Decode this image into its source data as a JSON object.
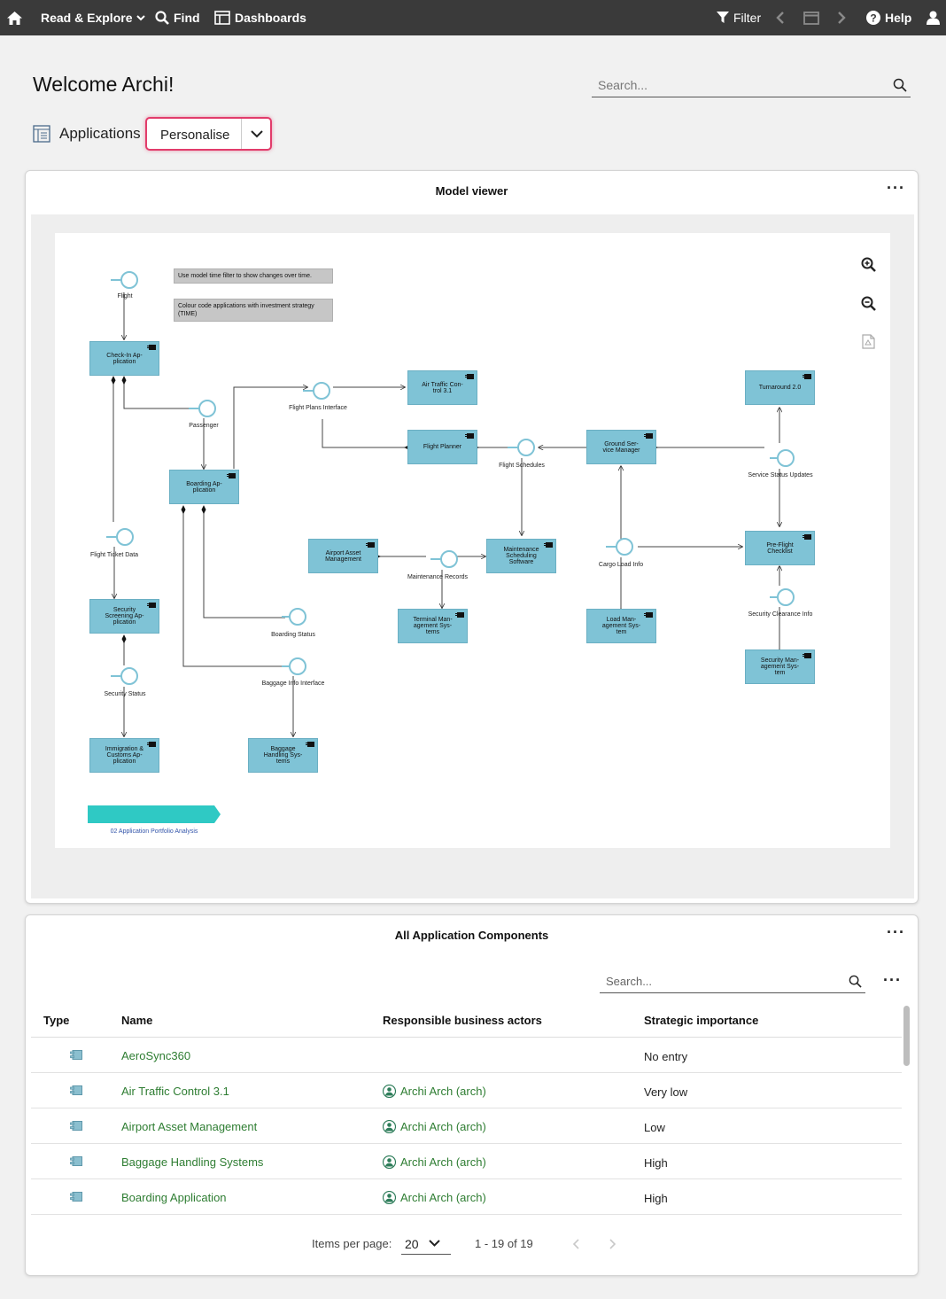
{
  "nav": {
    "read_explore": "Read & Explore",
    "find": "Find",
    "dashboards": "Dashboards",
    "filter": "Filter",
    "help": "Help"
  },
  "header": {
    "welcome": "Welcome Archi!",
    "search_placeholder": "Search..."
  },
  "context": {
    "label": "Applications",
    "personalise": "Personalise"
  },
  "model_viewer": {
    "title": "Model viewer",
    "notes": [
      "Use model time filter to show changes over time.",
      "Colour code applications with investment strategy (TIME)"
    ],
    "components": {
      "checkin": "Check-In Ap-\nplication",
      "atc": "Air Traffic Con-\ntrol 3.1",
      "turnaround": "Turnaround 2.0",
      "flight_planner": "Flight Planner",
      "ground_service": "Ground Ser-\nvice Manager",
      "boarding": "Boarding Ap-\nplication",
      "airport_asset": "Airport Asset\nManagement",
      "maintenance": "Maintenance\nScheduling\nSoftware",
      "preflight": "Pre-Flight\nChecklist",
      "security_screening": "Security\nScreening Ap-\nplication",
      "terminal": "Terminal Man-\nagement Sys-\ntems",
      "load": "Load Man-\nagement Sys-\ntem",
      "security_mgmt": "Security Man-\nagement Sys-\ntem",
      "immigration": "Immigration &\nCustoms Ap-\nplication",
      "baggage": "Baggage\nHandling Sys-\ntems"
    },
    "interfaces": {
      "flight": "Flight",
      "passenger": "Passenger",
      "flight_plans": "Flight Plans Interface",
      "flight_schedules": "Flight Schedules",
      "service_status": "Service Status Updates",
      "flight_ticket": "Flight Ticket Data",
      "maintenance_records": "Maintenance Records",
      "cargo_load": "Cargo Load Info",
      "security_clearance": "Security Clearance Info",
      "boarding_status": "Boarding Status",
      "security_status": "Security Status",
      "baggage_info": "Baggage Info Interface"
    },
    "view_label": "02 Application Portfolio Analysis"
  },
  "components_table": {
    "title": "All Application Components",
    "search_placeholder": "Search...",
    "columns": [
      "Type",
      "Name",
      "Responsible business actors",
      "Strategic importance"
    ],
    "rows": [
      {
        "name": "AeroSync360",
        "actor": "",
        "importance": "No entry"
      },
      {
        "name": "Air Traffic Control 3.1",
        "actor": "Archi Arch (arch)",
        "importance": "Very low"
      },
      {
        "name": "Airport Asset Management",
        "actor": "Archi Arch (arch)",
        "importance": "Low"
      },
      {
        "name": "Baggage Handling Systems",
        "actor": "Archi Arch (arch)",
        "importance": "High"
      },
      {
        "name": "Boarding Application",
        "actor": "Archi Arch (arch)",
        "importance": "High"
      }
    ],
    "pager": {
      "items_per_page_label": "Items per page:",
      "items_per_page": "20",
      "range": "1 - 19 of 19"
    }
  }
}
